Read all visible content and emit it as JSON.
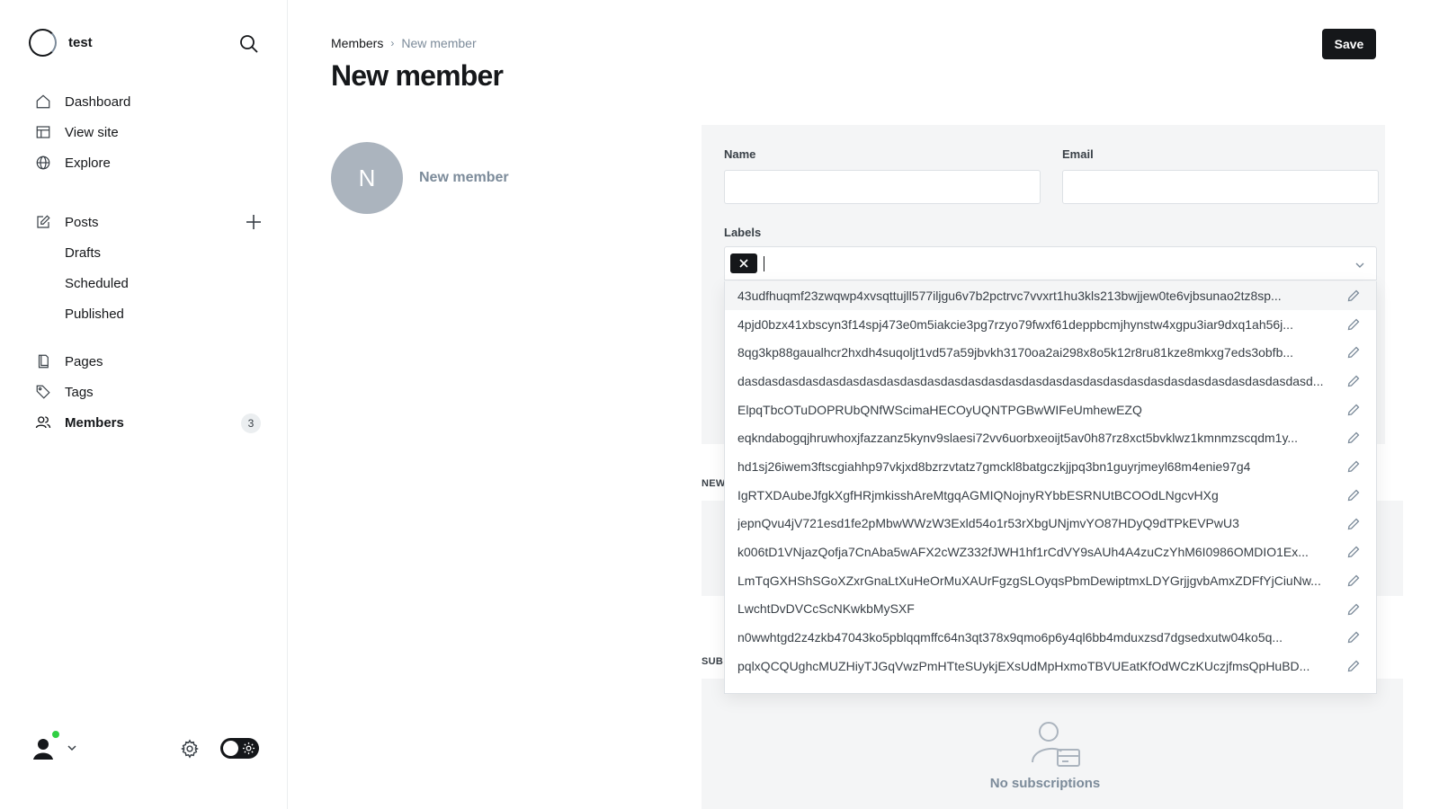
{
  "app": {
    "site_name": "test"
  },
  "nav": {
    "dashboard": "Dashboard",
    "view_site": "View site",
    "explore": "Explore",
    "posts": "Posts",
    "drafts": "Drafts",
    "scheduled": "Scheduled",
    "published": "Published",
    "pages": "Pages",
    "tags": "Tags",
    "members": "Members",
    "members_count": "3"
  },
  "breadcrumb": {
    "parent": "Members",
    "separator": "›",
    "current": "New member"
  },
  "header": {
    "title": "New member",
    "save_label": "Save"
  },
  "member": {
    "initial": "N",
    "name": "New member"
  },
  "form": {
    "name_label": "Name",
    "name_value": "",
    "email_label": "Email",
    "email_value": "",
    "labels_label": "Labels"
  },
  "sections": {
    "newsletters_head": "NEW",
    "subscriptions_head": "SUB",
    "no_subscriptions": "No subscriptions"
  },
  "label_options": [
    "43udfhuqmf23zwqwp4xvsqttujll577iljgu6v7b2pctrvc7vvxrt1hu3kls213bwjjew0te6vjbsunao2tz8sp...",
    "4pjd0bzx41xbscyn3f14spj473e0m5iakcie3pg7rzyo79fwxf61deppbcmjhynstw4xgpu3iar9dxq1ah56j...",
    "8qg3kp88gaualhcr2hxdh4suqoljt1vd57a59jbvkh3170oa2ai298x8o5k12r8ru81kze8mkxg7eds3obfb...",
    "dasdasdasdasdasdasdasdasdasdasdasdasdasdasdasdasdasdasdasdasdasdasdasdasdasdasdasdasd...",
    "ElpqTbcOTuDOPRUbQNfWScimaHECOyUQNTPGBwWIFeUmhewEZQ",
    "eqkndabogqjhruwhoxjfazzanz5kynv9slaesi72vv6uorbxeoijt5av0h87rz8xct5bvklwz1kmnmzscqdm1y...",
    "hd1sj26iwem3ftscgiahhp97vkjxd8bzrzvtatz7gmckl8batgczkjjpq3bn1guyrjmeyl68m4enie97g4",
    "IgRTXDAubeJfgkXgfHRjmkisshAreMtgqAGMIQNojnyRYbbESRNUtBCOOdLNgcvHXg",
    "jepnQvu4jV721esd1fe2pMbwWWzW3Exld54o1r53rXbgUNjmvYO87HDyQ9dTPkEVPwU3",
    "k006tD1VNjazQofja7CnAba5wAFX2cWZ332fJWH1hf1rCdVY9sAUh4A4zuCzYhM6I0986OMDIO1Ex...",
    "LmTqGXHShSGoXZxrGnaLtXuHeOrMuXAUrFgzgSLOyqsPbmDewiptmxLDYGrjjgvbAmxZDFfYjCiuNw...",
    "LwchtDvDVCcScNKwkbMySXF",
    "n0wwhtgd2z4zkb47043ko5pblqqmffc64n3qt378x9qmo6p6y4ql6bb4mduxzsd7dgsedxutw04ko5q...",
    "pqlxQCQUghcMUZHiyTJGqVwzPmHTteSUykjEXsUdMpHxmoTBVUEatKfOdWCzKUczjfmsQpHuBD..."
  ],
  "icons": {
    "brand": "brand-logo-icon",
    "search": "search-icon",
    "dashboard": "house-icon",
    "view_site": "layout-icon",
    "explore": "globe-icon",
    "posts": "pencil-square-icon",
    "posts_add": "plus-icon",
    "pages": "page-icon",
    "tags": "tag-icon",
    "members": "users-icon",
    "settings": "gear-icon",
    "theme": "sun-icon",
    "remove_token": "close-icon",
    "labels_dropdown": "chevron-down-icon",
    "edit_label": "pencil-icon",
    "no_subscriptions": "user-card-icon"
  },
  "colors": {
    "accent": "#15171a",
    "status_online": "#30cf43",
    "muted": "#7c8b9a",
    "panel": "#f4f5f6"
  }
}
